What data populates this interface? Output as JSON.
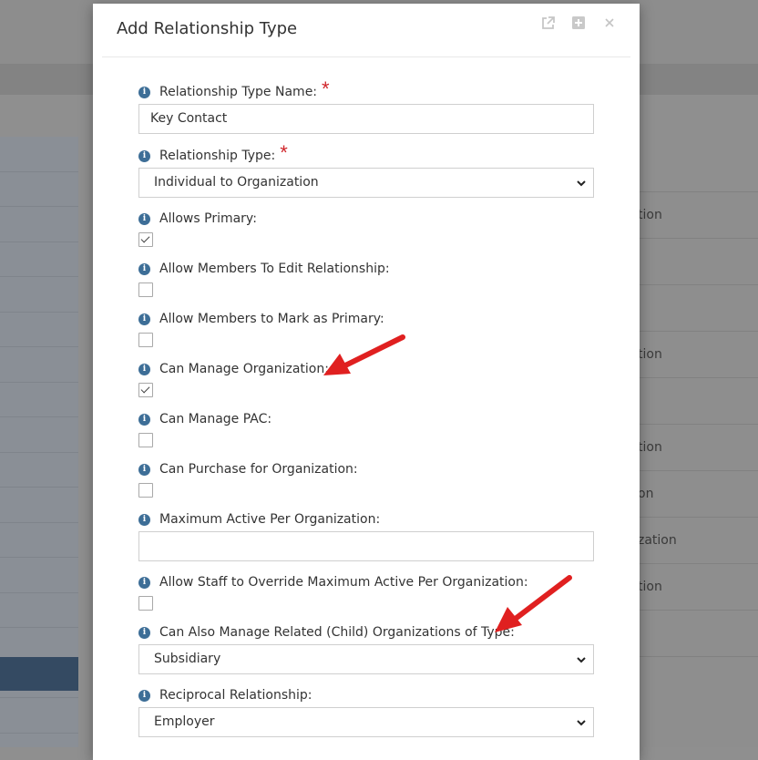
{
  "modal": {
    "title": "Add Relationship Type",
    "header_icons": [
      "external-link-icon",
      "expand-icon",
      "close-icon"
    ]
  },
  "fields": {
    "relationship_type_name": {
      "label": "Relationship Type Name:",
      "value": "Key Contact",
      "required": true
    },
    "relationship_type": {
      "label": "Relationship Type:",
      "value": "Individual to Organization",
      "required": true
    },
    "allows_primary": {
      "label": "Allows Primary:",
      "checked": true
    },
    "allow_members_edit": {
      "label": "Allow Members To Edit Relationship:",
      "checked": false
    },
    "allow_members_mark_primary": {
      "label": "Allow Members to Mark as Primary:",
      "checked": false
    },
    "can_manage_organization": {
      "label": "Can Manage Organization:",
      "checked": true
    },
    "can_manage_pac": {
      "label": "Can Manage PAC:",
      "checked": false
    },
    "can_purchase_for_org": {
      "label": "Can Purchase for Organization:",
      "checked": false
    },
    "maximum_active": {
      "label": "Maximum Active Per Organization:",
      "value": ""
    },
    "allow_staff_override": {
      "label": "Allow Staff to Override Maximum Active Per Organization:",
      "checked": false
    },
    "can_manage_child_orgs": {
      "label": "Can Also Manage Related (Child) Organizations of Type:",
      "value": "Subsidiary"
    },
    "reciprocal_relationship": {
      "label": "Reciprocal Relationship:",
      "value": "Employer"
    }
  },
  "required_marker": "*",
  "info_glyph": "i",
  "background_rows": [
    "tion",
    "",
    "",
    "tion",
    "",
    "tion",
    "on",
    "zation",
    "tion",
    "",
    ""
  ],
  "colors": {
    "accent_info": "#3d6e97",
    "required": "#d0262b",
    "annotation_arrow": "#e02020",
    "sidebar_active": "#344a62"
  }
}
